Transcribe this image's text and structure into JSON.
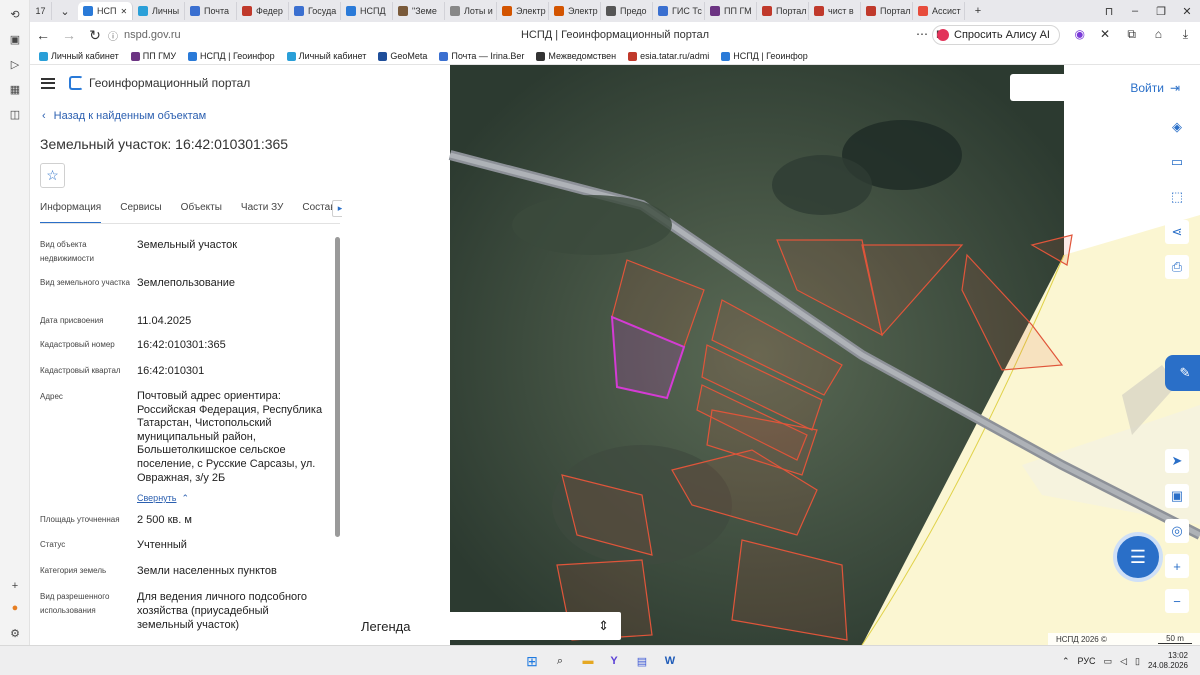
{
  "browser": {
    "tab_count": "17",
    "tabs": [
      {
        "label": "НСП",
        "active": true,
        "color": "#2a7ad8"
      },
      {
        "label": "Личны",
        "color": "#2a9fd8"
      },
      {
        "label": "Почта",
        "color": "#3a6fd0"
      },
      {
        "label": "Федер",
        "color": "#c0392b"
      },
      {
        "label": "Госуда",
        "color": "#3a6fd0"
      },
      {
        "label": "НСПД",
        "color": "#2a7ad8"
      },
      {
        "label": "\"Земе",
        "color": "#7a5a3a"
      },
      {
        "label": "Лоты и",
        "color": "#888888"
      },
      {
        "label": "Электр",
        "color": "#d35400"
      },
      {
        "label": "Электр",
        "color": "#d35400"
      },
      {
        "label": "Предо",
        "color": "#555555"
      },
      {
        "label": "ГИС Тс",
        "color": "#3a6fd0"
      },
      {
        "label": "ПП ГМ",
        "color": "#6c3483"
      },
      {
        "label": "Портал",
        "color": "#c0392b"
      },
      {
        "label": "чист в",
        "color": "#c0392b"
      },
      {
        "label": "Портал",
        "color": "#c0392b"
      },
      {
        "label": "Ассист",
        "color": "#e74c3c"
      }
    ],
    "url": "nspd.gov.ru",
    "page_title": "НСПД | Геоинформационный портал",
    "alisa_label": "Спросить Алису AI",
    "bookmarks": [
      {
        "label": "Личный кабинет",
        "color": "#2a9fd8"
      },
      {
        "label": "ПП ГМУ",
        "color": "#6c3483"
      },
      {
        "label": "НСПД | Геоинфор",
        "color": "#2a7ad8"
      },
      {
        "label": "Личный кабинет",
        "color": "#2a9fd8"
      },
      {
        "label": "GeoMeta",
        "color": "#1f4e9a"
      },
      {
        "label": "Почта — Irina.Ber",
        "color": "#3a6fd0"
      },
      {
        "label": "Межведомствен",
        "color": "#333333"
      },
      {
        "label": "esia.tatar.ru/admi",
        "color": "#c0392b"
      },
      {
        "label": "НСПД | Геоинфор",
        "color": "#2a7ad8"
      }
    ]
  },
  "app": {
    "title": "Геоинформационный портал",
    "back_label": "Назад к найденным объектам",
    "object_title": "Земельный участок: 16:42:010301:365",
    "tabs": [
      "Информация",
      "Сервисы",
      "Объекты",
      "Части ЗУ",
      "Состав"
    ],
    "properties": [
      {
        "label": "Вид объекта недвижимости",
        "value": "Земельный участок"
      },
      {
        "label": "Вид земельного участка",
        "value": "Землепользование"
      },
      {
        "label": "Дата присвоения",
        "value": "11.04.2025"
      },
      {
        "label": "Кадастровый номер",
        "value": "16:42:010301:365"
      },
      {
        "label": "Кадастровый квартал",
        "value": "16:42:010301"
      },
      {
        "label": "Адрес",
        "value": "Почтовый адрес ориентира: Российская Федерация, Республика Татарстан, Чистопольский муниципальный район, Большетолкишское сельское поселение, с Русские Сарсазы, ул. Овражная, з/у 2Б"
      },
      {
        "label": "Площадь уточненная",
        "value": "2 500 кв. м"
      },
      {
        "label": "Статус",
        "value": "Учтенный"
      },
      {
        "label": "Категория земель",
        "value": "Земли населенных пунктов"
      },
      {
        "label": "Вид разрешенного использования",
        "value": "Для ведения личного подсобного хозяйства (приусадебный земельный участок)"
      }
    ],
    "collapse_label": "Свернуть"
  },
  "map": {
    "login_label": "Войти",
    "legend_label": "Легенда",
    "copyright": "НСПД 2026 ©",
    "scale_label": "50 m",
    "parcel_color": "#e0553a",
    "selected_color": "#d43bd4"
  },
  "taskbar": {
    "lang": "РУС",
    "time": "13:02",
    "date": "24.08.2026"
  }
}
